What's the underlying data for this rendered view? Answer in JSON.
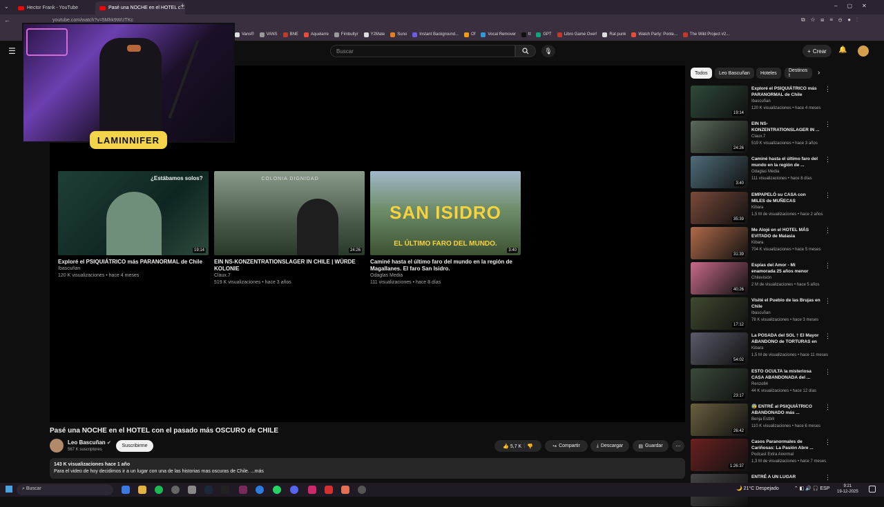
{
  "browser": {
    "tabs": [
      {
        "label": "Hector Frank - YouTube"
      },
      {
        "label": "Pasé una NOCHE en el HOTEL c..."
      }
    ],
    "url": "youtube.com/watch?v=5Mhk9WUTKc",
    "bookmarks": [
      "Vans®",
      "VANS",
      "BNE",
      "Aquelarre",
      "Fimbultyr",
      "Y2Mate",
      "Suno",
      "Instant Background...",
      "Of",
      "Vocal Remover",
      "tt",
      "GPT",
      "Libro Game Over!",
      "Rat punk",
      "Watch Party: Ponte...",
      "The Wild Project #2..."
    ]
  },
  "header": {
    "search_placeholder": "Buscar",
    "create_label": "Crear"
  },
  "webcam": {
    "logo_text": "LAMINNIFER"
  },
  "endscreen": [
    {
      "title": "Exploré el PSIQUIÁTRICO más PARANORMAL de Chile",
      "channel": "Ibascuñan",
      "meta": "120 K visualizaciones • hace 4 meses",
      "duration": "19:14",
      "overlay": "¿Estábamos solos?"
    },
    {
      "title": "EIN NS-KONZENTRATIONSLAGER IN CHILE | WÜRDE KOLONIE",
      "channel": "Claux.7",
      "meta": "519 K visualizaciones • hace 3 años",
      "duration": "24:26",
      "overlay": "COLONIA DIGNIDAD"
    },
    {
      "title": "Caminé hasta el último faro del mundo en la región de Magallanes. El faro San Isidro.",
      "channel": "Odaglas Media",
      "meta": "111 visualizaciones • hace 8 días",
      "duration": "3:40",
      "overlay": "SAN ISIDRO",
      "overlay2": "EL ÚLTIMO FARO DEL MUNDO."
    }
  ],
  "video": {
    "title": "Pasé una NOCHE en el HOTEL con el pasado más OSCURO de CHILE",
    "channel": "Leo Bascuñan",
    "subscribers": "567 K suscriptores",
    "subscribe_label": "Suscribirme",
    "likes": "5,7 K",
    "share_label": "Compartir",
    "download_label": "Descargar",
    "save_label": "Guardar",
    "desc_stats": "143 K visualizaciones  hace 1 año",
    "desc_text": "Para el video de hoy decidimos ir a un lugar con una de las historias mas oscuras de Chile.  ...más"
  },
  "chips": [
    "Todos",
    "Leo Bascuñan",
    "Hoteles",
    "Destinos t"
  ],
  "recommended": [
    {
      "title": "Exploré el PSIQUIÁTRICO más PARANORMAL de Chile",
      "channel": "Ibascuñan",
      "meta": "120 K visualizaciones • hace 4 meses",
      "duration": "19:14",
      "color": "#2f4a3a"
    },
    {
      "title": "EIN NS-KONZENTRATIONSLAGER IN ...",
      "channel": "Claux.7",
      "meta": "519 K visualizaciones • hace 3 años",
      "duration": "24:26",
      "color": "#5a6a5a"
    },
    {
      "title": "Caminé hasta el último faro del mundo en la región de ...",
      "channel": "Odaglas Media",
      "meta": "111 visualizaciones • hace 8 días",
      "duration": "3:40",
      "color": "#4f6d7a"
    },
    {
      "title": "EMPAPELÓ su CASA con MILES de MUÑECAS ABANDONADAS...",
      "channel": "Kibara",
      "meta": "1,5 M de visualizaciones • hace 2 años",
      "duration": "35:39",
      "color": "#7a4a3a"
    },
    {
      "title": "Me Alojé en el HOTEL MÁS EVITADO de Malasia",
      "channel": "Kibara",
      "meta": "704 K visualizaciones • hace 5 meses",
      "duration": "31:39",
      "color": "#b06a4a"
    },
    {
      "title": "Espías del Amor - Mi enamorada 25 años menor",
      "channel": "Chilevisión",
      "meta": "2 M de visualizaciones • hace 5 años",
      "duration": "40:26",
      "color": "#c86a8a"
    },
    {
      "title": "Visité el Pueblo de las Brujas en Chile",
      "channel": "Ibascuñan",
      "meta": "78 K visualizaciones • hace 3 meses",
      "duration": "17:12",
      "color": "#3f4a2f"
    },
    {
      "title": "La POSADA del SOL † El Mayor ABANDONO de TORTURAS en ...",
      "channel": "Kibara",
      "meta": "1,5 M de visualizaciones • hace 11 meses",
      "duration": "54:02",
      "color": "#5a5a6a"
    },
    {
      "title": "ESTO OCULTA la misteriosa CASA ABANDONADA del ...",
      "channel": "Renzo84",
      "meta": "44 K visualizaciones • hace 12 días",
      "duration": "23:17",
      "color": "#3a4a3a"
    },
    {
      "title": "😰 ENTRÉ al PSIQUIÁTRICO ABANDONADO más ...",
      "channel": "Benja Estbill",
      "meta": "110 K visualizaciones • hace 6 meses",
      "duration": "26:42",
      "color": "#6a6040"
    },
    {
      "title": "Casos Paranormales de Cariñosas: La Pasión Abre ...",
      "channel": "Podcast Extra Anormal",
      "meta": "1,3 M de visualizaciones • hace 7 meses",
      "duration": "1:26:37",
      "color": "#6a2020"
    },
    {
      "title": "ENTRÉ A UN LUGAR",
      "channel": "",
      "meta": "",
      "duration": "",
      "color": "#444"
    }
  ],
  "taskbar": {
    "search_label": "Buscar",
    "weather": "21°C  Despejado",
    "lang": "ESP",
    "time": "9:21",
    "date": "19-12-2025"
  }
}
